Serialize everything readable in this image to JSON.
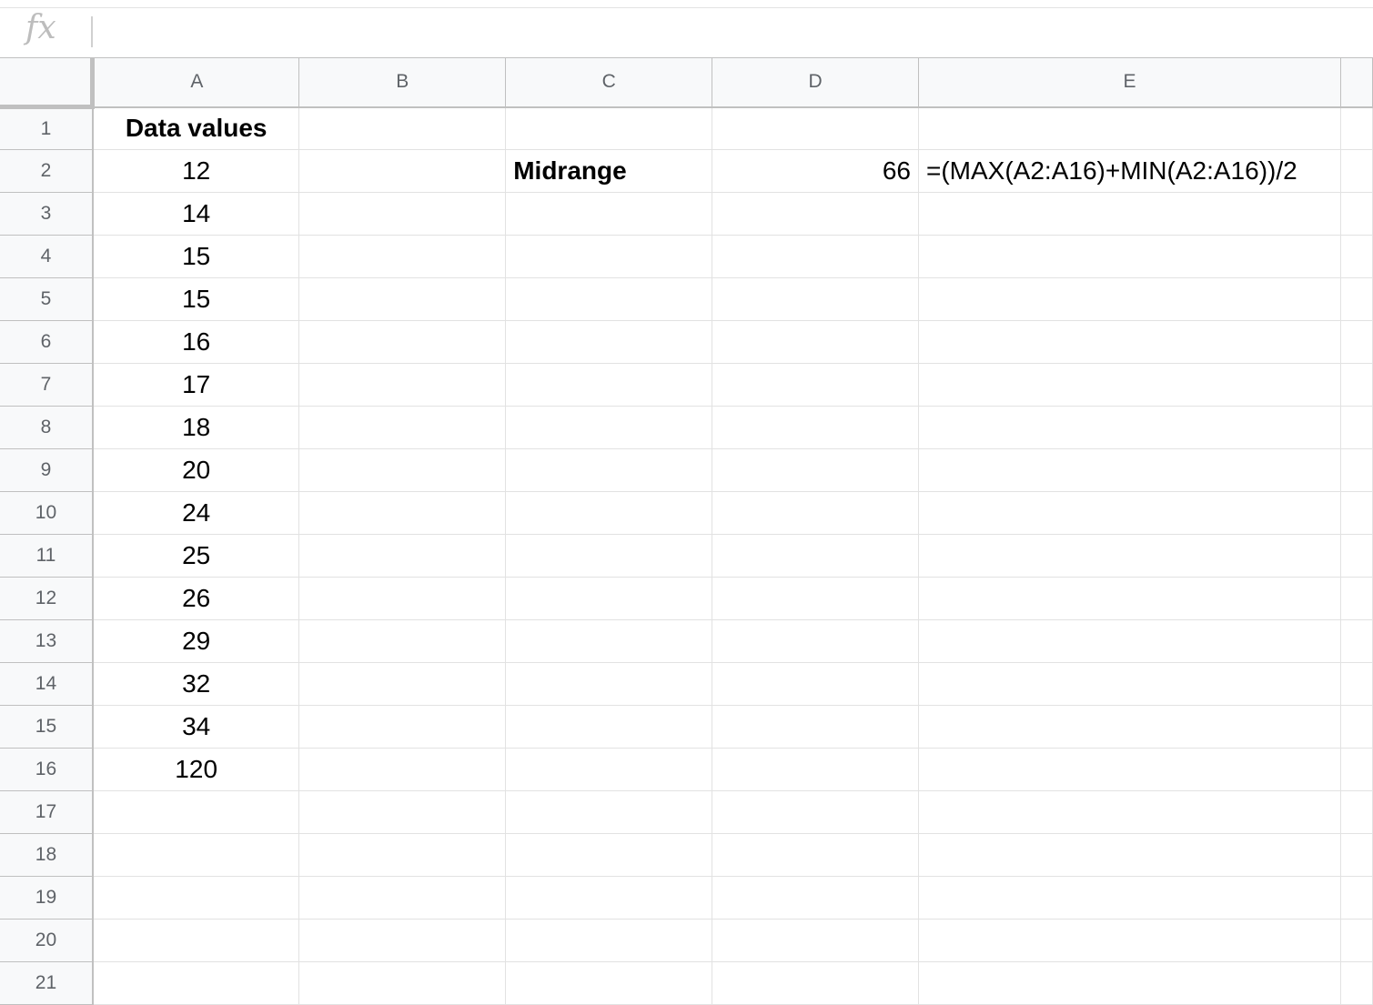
{
  "formula_bar": {
    "icon": "fx",
    "value": ""
  },
  "columns": [
    "A",
    "B",
    "C",
    "D",
    "E",
    ""
  ],
  "rows": [
    {
      "num": "1",
      "A": "Data values",
      "B": "",
      "C": "",
      "D": "",
      "E": ""
    },
    {
      "num": "2",
      "A": "12",
      "B": "",
      "C": "Midrange",
      "D": "66",
      "E": "=(MAX(A2:A16)+MIN(A2:A16))/2"
    },
    {
      "num": "3",
      "A": "14",
      "B": "",
      "C": "",
      "D": "",
      "E": ""
    },
    {
      "num": "4",
      "A": "15",
      "B": "",
      "C": "",
      "D": "",
      "E": ""
    },
    {
      "num": "5",
      "A": "15",
      "B": "",
      "C": "",
      "D": "",
      "E": ""
    },
    {
      "num": "6",
      "A": "16",
      "B": "",
      "C": "",
      "D": "",
      "E": ""
    },
    {
      "num": "7",
      "A": "17",
      "B": "",
      "C": "",
      "D": "",
      "E": ""
    },
    {
      "num": "8",
      "A": "18",
      "B": "",
      "C": "",
      "D": "",
      "E": ""
    },
    {
      "num": "9",
      "A": "20",
      "B": "",
      "C": "",
      "D": "",
      "E": ""
    },
    {
      "num": "10",
      "A": "24",
      "B": "",
      "C": "",
      "D": "",
      "E": ""
    },
    {
      "num": "11",
      "A": "25",
      "B": "",
      "C": "",
      "D": "",
      "E": ""
    },
    {
      "num": "12",
      "A": "26",
      "B": "",
      "C": "",
      "D": "",
      "E": ""
    },
    {
      "num": "13",
      "A": "29",
      "B": "",
      "C": "",
      "D": "",
      "E": ""
    },
    {
      "num": "14",
      "A": "32",
      "B": "",
      "C": "",
      "D": "",
      "E": ""
    },
    {
      "num": "15",
      "A": "34",
      "B": "",
      "C": "",
      "D": "",
      "E": ""
    },
    {
      "num": "16",
      "A": "120",
      "B": "",
      "C": "",
      "D": "",
      "E": ""
    },
    {
      "num": "17",
      "A": "",
      "B": "",
      "C": "",
      "D": "",
      "E": ""
    },
    {
      "num": "18",
      "A": "",
      "B": "",
      "C": "",
      "D": "",
      "E": ""
    },
    {
      "num": "19",
      "A": "",
      "B": "",
      "C": "",
      "D": "",
      "E": ""
    },
    {
      "num": "20",
      "A": "",
      "B": "",
      "C": "",
      "D": "",
      "E": ""
    },
    {
      "num": "21",
      "A": "",
      "B": "",
      "C": "",
      "D": "",
      "E": ""
    }
  ]
}
